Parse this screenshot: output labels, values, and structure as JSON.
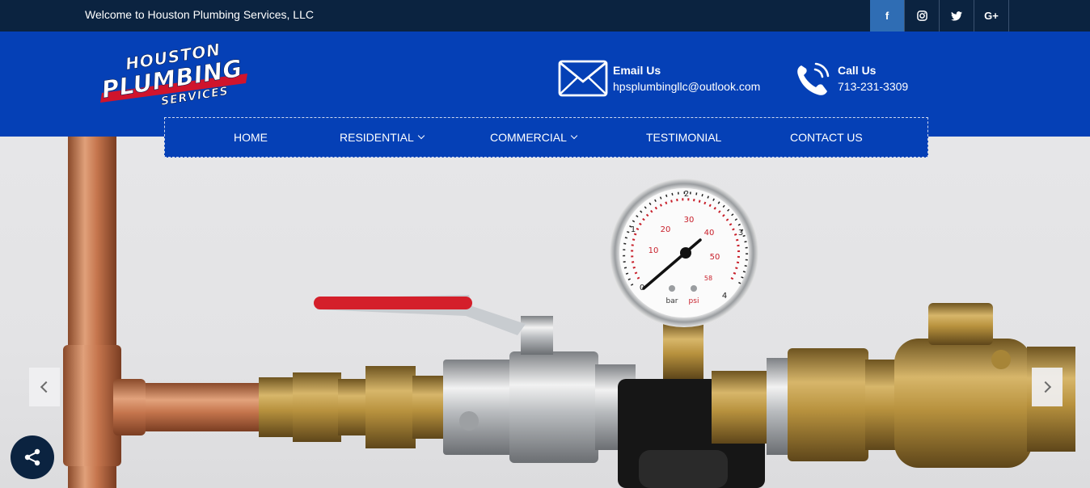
{
  "topbar": {
    "welcome": "Welcome to Houston Plumbing Services, LLC",
    "socials": [
      {
        "icon": "facebook-icon",
        "glyph": "f"
      },
      {
        "icon": "instagram-icon",
        "glyph": ""
      },
      {
        "icon": "twitter-icon",
        "glyph": ""
      },
      {
        "icon": "google-plus-icon",
        "glyph": "G+"
      }
    ]
  },
  "logo": {
    "line1": "HOUSTON",
    "line2": "PLUMBING",
    "line3": "SERVICES"
  },
  "contact": {
    "email_title": "Email Us",
    "email_value": "hpsplumbingllc@outlook.com",
    "call_title": "Call Us",
    "call_value": "713-231-3309"
  },
  "nav": {
    "items": [
      {
        "label": "HOME",
        "dropdown": false
      },
      {
        "label": "RESIDENTIAL",
        "dropdown": true
      },
      {
        "label": "COMMERCIAL",
        "dropdown": true
      },
      {
        "label": "TESTIMONIAL",
        "dropdown": false
      },
      {
        "label": "CONTACT US",
        "dropdown": false
      }
    ]
  },
  "gauge": {
    "bar_label": "bar",
    "psi_label": "psi",
    "bar_ticks": [
      "0",
      "1",
      "2",
      "3",
      "4"
    ],
    "psi_ticks": [
      "10",
      "20",
      "30",
      "40",
      "50",
      "58"
    ]
  },
  "colors": {
    "topbar": "#0b2340",
    "header": "#0540b6",
    "facebook_active": "#2f6db4",
    "logo_red": "#d0142c"
  }
}
